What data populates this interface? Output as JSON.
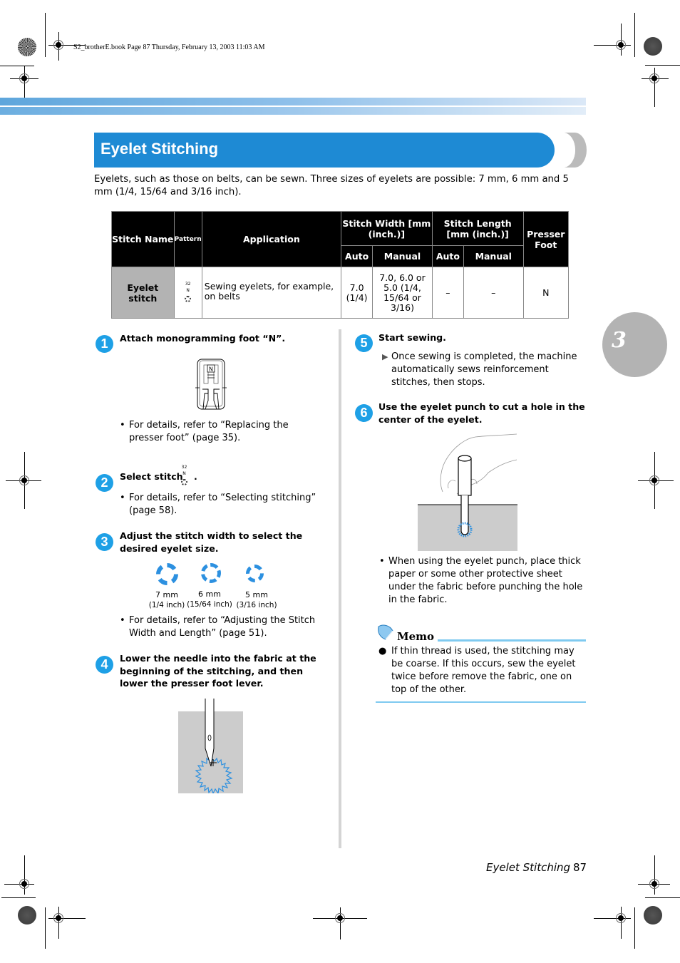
{
  "print_meta": "S2_brotherE.book  Page 87  Thursday, February 13, 2003  11:03 AM",
  "section_title": "Eyelet Stitching",
  "intro": "Eyelets, such as those on belts, can be sewn. Three sizes of eyelets are possible: 7 mm, 6 mm and 5 mm (1/4, 15/64 and 3/16 inch).",
  "table": {
    "headers": {
      "stitch_name": "Stitch Name",
      "pattern": "Pattern",
      "application": "Application",
      "stitch_width": "Stitch Width [mm (inch.)]",
      "stitch_length": "Stitch Length [mm (inch.)]",
      "presser_foot": "Presser Foot",
      "auto": "Auto",
      "manual": "Manual"
    },
    "rows": [
      {
        "stitch_name": "Eyelet stitch",
        "pattern_number": "32",
        "pattern_letter": "N",
        "application": "Sewing eyelets, for example, on belts",
        "width_auto": "7.0 (1/4)",
        "width_manual": "7.0, 6.0 or 5.0 (1/4, 15/64 or 3/16)",
        "length_auto": "–",
        "length_manual": "–",
        "presser_foot": "N"
      }
    ]
  },
  "steps": [
    {
      "num": "1",
      "title": "Attach monogramming foot “N”.",
      "foot_label": "N",
      "note": "For details, refer to “Replacing the presser foot” (page 35)."
    },
    {
      "num": "2",
      "title": "Select stitch",
      "pattern_number": "32",
      "pattern_letter": "N",
      "note": "For details, refer to “Selecting stitching” (page 58)."
    },
    {
      "num": "3",
      "title": "Adjust the stitch width to select the desired eyelet size.",
      "sizes": [
        {
          "mm": "7 mm",
          "inch": "(1/4 inch)"
        },
        {
          "mm": "6 mm",
          "inch": "(15/64 inch)"
        },
        {
          "mm": "5 mm",
          "inch": "(3/16 inch)"
        }
      ],
      "note": "For details, refer to “Adjusting the Stitch Width and Length” (page 51)."
    },
    {
      "num": "4",
      "title": "Lower the needle into the fabric at the beginning of the stitching, and then lower the presser foot lever."
    },
    {
      "num": "5",
      "title": "Start sewing.",
      "result": "Once sewing is completed, the machine automatically sews reinforcement stitches, then stops."
    },
    {
      "num": "6",
      "title": "Use the eyelet punch to cut a hole in the center of the eyelet.",
      "note": "When using the eyelet punch, place thick paper or some other protective sheet under the fabric before punching the hole in the fabric."
    }
  ],
  "memo": {
    "title": "Memo",
    "text": "If thin thread is used, the stitching may be coarse. If this occurs, sew the eyelet twice before remove the fabric, one on top of the other."
  },
  "chapter_number": "3",
  "footer": {
    "section": "Eyelet Stitching",
    "page": "87"
  },
  "colors": {
    "accent_blue": "#1e8ad4",
    "step_blue": "#1ea0e6",
    "chapter_gray": "#b3b3b3"
  }
}
